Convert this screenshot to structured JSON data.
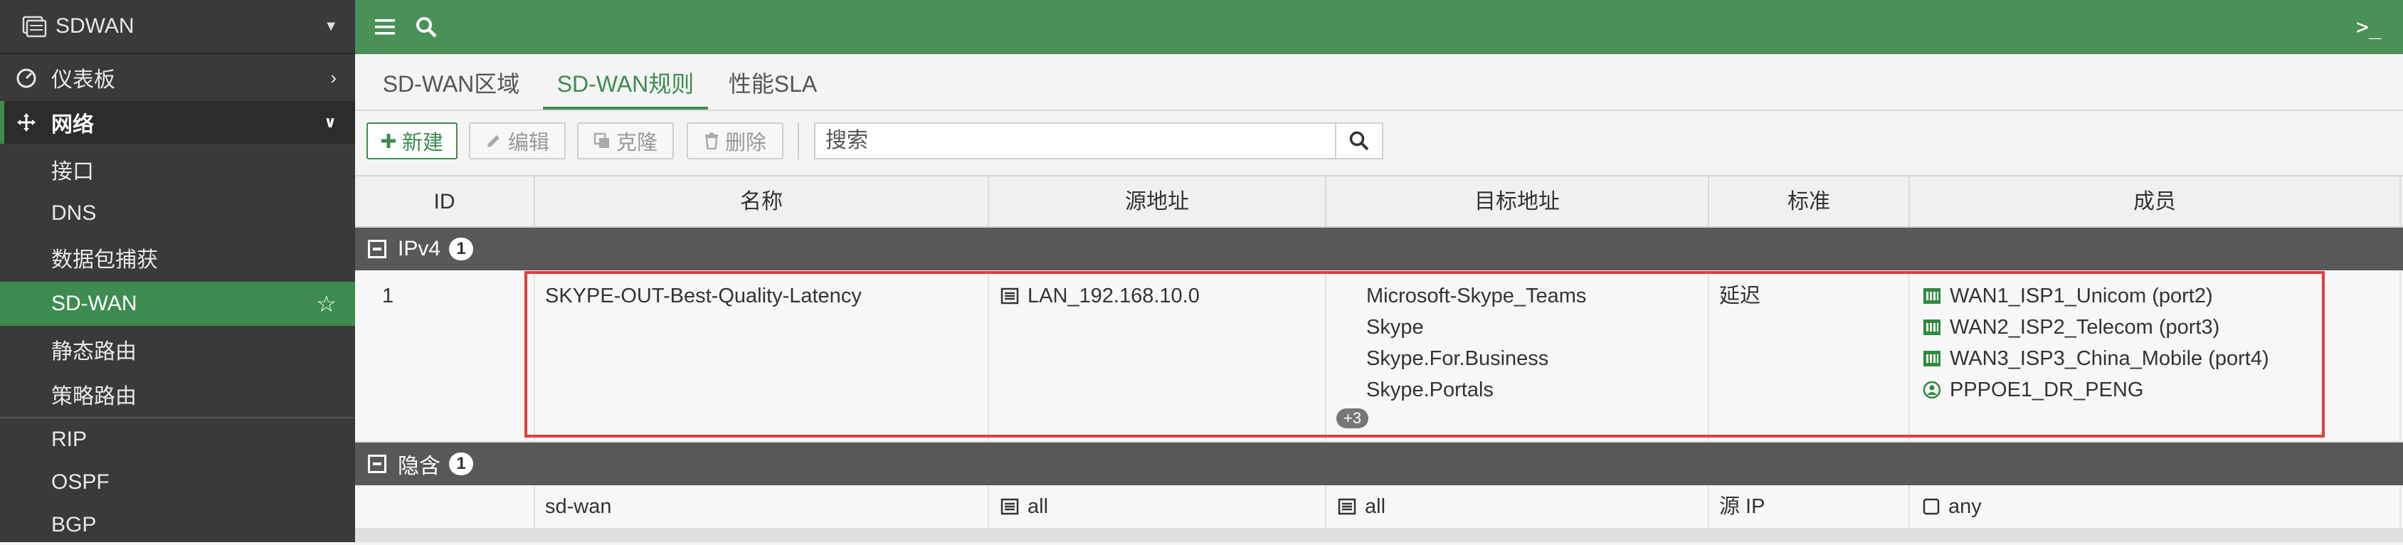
{
  "sidebar": {
    "header_title": "SDWAN",
    "items": [
      {
        "label": "仪表板"
      },
      {
        "label": "网络"
      },
      {
        "label": "接口"
      },
      {
        "label": "DNS"
      },
      {
        "label": "数据包捕获"
      },
      {
        "label": "SD-WAN"
      },
      {
        "label": "静态路由"
      },
      {
        "label": "策略路由"
      },
      {
        "label": "RIP"
      },
      {
        "label": "OSPF"
      },
      {
        "label": "BGP"
      }
    ]
  },
  "topbar": {
    "menu_icon": "hamburger-icon",
    "search_icon": "search-icon",
    "cli_label": ">_"
  },
  "tabs": [
    {
      "label": "SD-WAN区域"
    },
    {
      "label": "SD-WAN规则",
      "active": true
    },
    {
      "label": "性能SLA"
    }
  ],
  "toolbar": {
    "new_label": "新建",
    "edit_label": "编辑",
    "clone_label": "克隆",
    "delete_label": "删除",
    "search_placeholder": "搜索"
  },
  "table": {
    "columns": [
      "ID",
      "名称",
      "源地址",
      "目标地址",
      "标准",
      "成员"
    ],
    "groups": [
      {
        "label": "IPv4",
        "count": "1",
        "rows": [
          {
            "id": "1",
            "name": "SKYPE-OUT-Best-Quality-Latency",
            "source": "LAN_192.168.10.0",
            "destinations": [
              "Microsoft-Skype_Teams",
              "Skype",
              "Skype.For.Business",
              "Skype.Portals"
            ],
            "destinations_more": "+3",
            "criteria": "延迟",
            "members": [
              {
                "label": "WAN1_ISP1_Unicom (port2)",
                "icon": "interface-icon"
              },
              {
                "label": "WAN2_ISP2_Telecom (port3)",
                "icon": "interface-icon"
              },
              {
                "label": "WAN3_ISP3_China_Mobile (port4)",
                "icon": "interface-icon"
              },
              {
                "label": "PPPOE1_DR_PENG",
                "icon": "pppoe-icon"
              }
            ]
          }
        ]
      },
      {
        "label": "隐含",
        "count": "1",
        "rows": [
          {
            "id": "",
            "name": "sd-wan",
            "source": "all",
            "destination": "all",
            "criteria": "源 IP",
            "member": "any"
          }
        ]
      }
    ]
  },
  "colors": {
    "brand_green": "#4a9158",
    "sidebar_bg": "#3a3a3a",
    "highlight_red": "#e53b3b"
  }
}
